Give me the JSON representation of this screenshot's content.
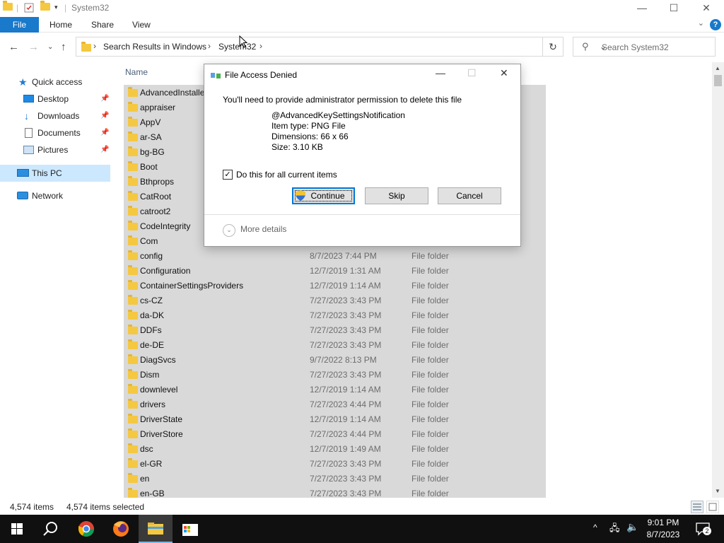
{
  "window": {
    "title": "System32",
    "minimize": "—",
    "maximize": "☐",
    "close": "✕"
  },
  "ribbon": {
    "file": "File",
    "home": "Home",
    "share": "Share",
    "view": "View",
    "help": "?"
  },
  "address": {
    "crumbs": [
      "Search Results in Windows",
      "System32"
    ],
    "search_placeholder": "Search System32"
  },
  "nav": {
    "quick_access": "Quick access",
    "desktop": "Desktop",
    "downloads": "Downloads",
    "documents": "Documents",
    "pictures": "Pictures",
    "this_pc": "This PC",
    "network": "Network"
  },
  "list": {
    "col_name": "Name",
    "rows": [
      {
        "name": "AdvancedInstallers",
        "date": "",
        "type": ""
      },
      {
        "name": "appraiser",
        "date": "",
        "type": ""
      },
      {
        "name": "AppV",
        "date": "",
        "type": ""
      },
      {
        "name": "ar-SA",
        "date": "",
        "type": ""
      },
      {
        "name": "bg-BG",
        "date": "",
        "type": ""
      },
      {
        "name": "Boot",
        "date": "",
        "type": ""
      },
      {
        "name": "Bthprops",
        "date": "",
        "type": ""
      },
      {
        "name": "CatRoot",
        "date": "",
        "type": ""
      },
      {
        "name": "catroot2",
        "date": "",
        "type": ""
      },
      {
        "name": "CodeIntegrity",
        "date": "",
        "type": ""
      },
      {
        "name": "Com",
        "date": "",
        "type": ""
      },
      {
        "name": "config",
        "date": "8/7/2023 7:44 PM",
        "type": "File folder"
      },
      {
        "name": "Configuration",
        "date": "12/7/2019 1:31 AM",
        "type": "File folder"
      },
      {
        "name": "ContainerSettingsProviders",
        "date": "12/7/2019 1:14 AM",
        "type": "File folder"
      },
      {
        "name": "cs-CZ",
        "date": "7/27/2023 3:43 PM",
        "type": "File folder"
      },
      {
        "name": "da-DK",
        "date": "7/27/2023 3:43 PM",
        "type": "File folder"
      },
      {
        "name": "DDFs",
        "date": "7/27/2023 3:43 PM",
        "type": "File folder"
      },
      {
        "name": "de-DE",
        "date": "7/27/2023 3:43 PM",
        "type": "File folder"
      },
      {
        "name": "DiagSvcs",
        "date": "9/7/2022 8:13 PM",
        "type": "File folder"
      },
      {
        "name": "Dism",
        "date": "7/27/2023 3:43 PM",
        "type": "File folder"
      },
      {
        "name": "downlevel",
        "date": "12/7/2019 1:14 AM",
        "type": "File folder"
      },
      {
        "name": "drivers",
        "date": "7/27/2023 4:44 PM",
        "type": "File folder"
      },
      {
        "name": "DriverState",
        "date": "12/7/2019 1:14 AM",
        "type": "File folder"
      },
      {
        "name": "DriverStore",
        "date": "7/27/2023 4:44 PM",
        "type": "File folder"
      },
      {
        "name": "dsc",
        "date": "12/7/2019 1:49 AM",
        "type": "File folder"
      },
      {
        "name": "el-GR",
        "date": "7/27/2023 3:43 PM",
        "type": "File folder"
      },
      {
        "name": "en",
        "date": "7/27/2023 3:43 PM",
        "type": "File folder"
      },
      {
        "name": "en-GB",
        "date": "7/27/2023 3:43 PM",
        "type": "File folder"
      }
    ]
  },
  "status": {
    "items": "4,574 items",
    "selected": "4,574 items selected"
  },
  "dialog": {
    "title": "File Access Denied",
    "message": "You'll need to provide administrator permission to delete this file",
    "file_name": "@AdvancedKeySettingsNotification",
    "item_type": "Item type: PNG File",
    "dimensions": "Dimensions: 66 x 66",
    "size": "Size: 3.10 KB",
    "checkbox_label": "Do this for all current items",
    "checked": true,
    "continue": "Continue",
    "skip": "Skip",
    "cancel": "Cancel",
    "more_details": "More details"
  },
  "taskbar": {
    "time": "9:01 PM",
    "date": "8/7/2023",
    "notifications": "2"
  }
}
